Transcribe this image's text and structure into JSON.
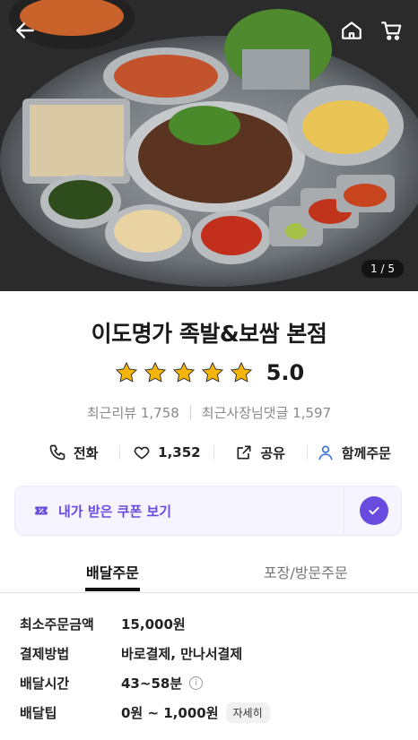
{
  "header": {
    "back_icon": "back-arrow-icon",
    "home_icon": "home-icon",
    "cart_icon": "cart-icon",
    "image_counter": "1 / 5"
  },
  "store": {
    "name": "이도명가 족발&보쌈 본점",
    "rating": 5.0,
    "rating_text": "5.0",
    "stars_filled": 5,
    "star_color": "#f5b40a",
    "recent_reviews": "최근리뷰 1,758",
    "owner_replies": "최근사장님댓글 1,597"
  },
  "actions": {
    "call_label": "전화",
    "like_count": "1,352",
    "share_label": "공유",
    "group_order_label": "함께주문"
  },
  "coupon": {
    "label": "내가 받은 쿠폰 보기",
    "accent": "#6a4be0"
  },
  "tabs": [
    {
      "label": "배달주문",
      "active": true
    },
    {
      "label": "포장/방문주문",
      "active": false
    }
  ],
  "info": {
    "min_order": {
      "label": "최소주문금액",
      "value": "15,000원"
    },
    "payment": {
      "label": "결제방법",
      "value": "바로결제, 만나서결제"
    },
    "delivery_time": {
      "label": "배달시간",
      "value": "43~58분"
    },
    "delivery_tip": {
      "label": "배달팁",
      "value": "0원 ~ 1,000원",
      "detail_label": "자세히"
    }
  }
}
